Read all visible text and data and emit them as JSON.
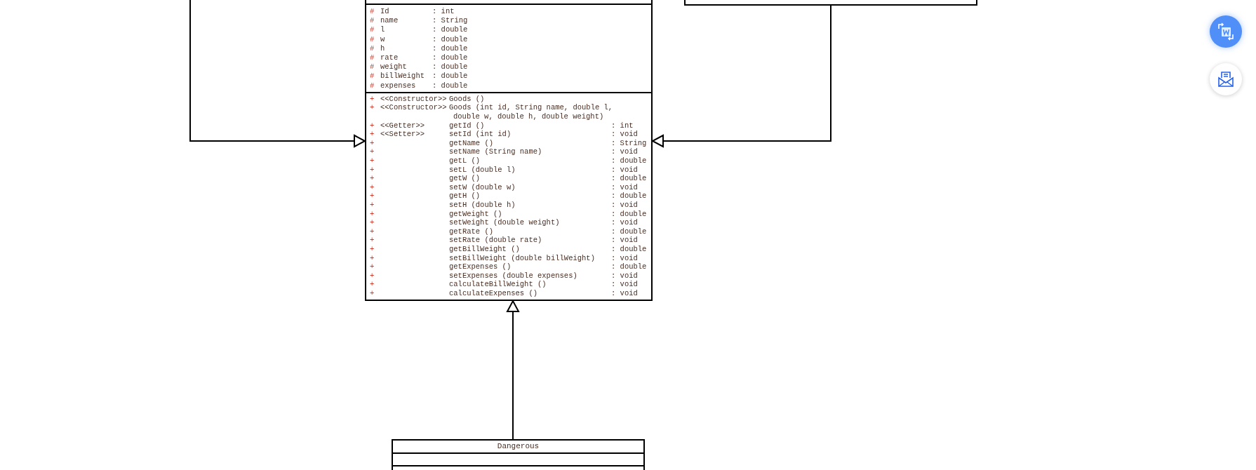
{
  "goods_class": {
    "attributes": [
      {
        "visibility": "#",
        "name": "Id",
        "type": ": int"
      },
      {
        "visibility": "#",
        "name": "name",
        "type": ": String"
      },
      {
        "visibility": "#",
        "name": "l",
        "type": ": double"
      },
      {
        "visibility": "#",
        "name": "w",
        "type": ": double"
      },
      {
        "visibility": "#",
        "name": "h",
        "type": ": double"
      },
      {
        "visibility": "#",
        "name": "rate",
        "type": ": double"
      },
      {
        "visibility": "#",
        "name": "weight",
        "type": ": double"
      },
      {
        "visibility": "#",
        "name": "billWeight",
        "type": ": double"
      },
      {
        "visibility": "#",
        "name": "expenses",
        "type": ": double"
      }
    ],
    "methods": [
      {
        "visibility": "+",
        "stereotype": "<<Constructor>>",
        "lines": [
          "Goods ()"
        ]
      },
      {
        "visibility": "+",
        "stereotype": "<<Constructor>>",
        "lines": [
          "Goods (int id, String name, double l,",
          "double w, double h, double weight)"
        ]
      },
      {
        "visibility": "+",
        "stereotype": "<<Getter>>",
        "lines": [
          "getId ()"
        ],
        "type": ": int"
      },
      {
        "visibility": "+",
        "stereotype": "<<Setter>>",
        "lines": [
          "setId (int id)"
        ],
        "type": ": void"
      },
      {
        "visibility": "+",
        "lines": [
          "getName ()"
        ],
        "type": ": String"
      },
      {
        "visibility": "+",
        "lines": [
          "setName (String name)"
        ],
        "type": ": void"
      },
      {
        "visibility": "+",
        "lines": [
          "getL ()"
        ],
        "type": ": double"
      },
      {
        "visibility": "+",
        "lines": [
          "setL (double l)"
        ],
        "type": ": void"
      },
      {
        "visibility": "+",
        "lines": [
          "getW ()"
        ],
        "type": ": double"
      },
      {
        "visibility": "+",
        "lines": [
          "setW (double w)"
        ],
        "type": ": void"
      },
      {
        "visibility": "+",
        "lines": [
          "getH ()"
        ],
        "type": ": double"
      },
      {
        "visibility": "+",
        "lines": [
          "setH (double h)"
        ],
        "type": ": void"
      },
      {
        "visibility": "+",
        "lines": [
          "getWeight ()"
        ],
        "type": ": double"
      },
      {
        "visibility": "+",
        "lines": [
          "setWeight (double weight)"
        ],
        "type": ": void"
      },
      {
        "visibility": "+",
        "lines": [
          "getRate ()"
        ],
        "type": ": double"
      },
      {
        "visibility": "+",
        "lines": [
          "setRate (double rate)"
        ],
        "type": ": void"
      },
      {
        "visibility": "+",
        "lines": [
          "getBillWeight ()"
        ],
        "type": ": double"
      },
      {
        "visibility": "+",
        "lines": [
          "setBillWeight (double billWeight)"
        ],
        "type": ": void"
      },
      {
        "visibility": "+",
        "lines": [
          "getExpenses ()"
        ],
        "type": ": double"
      },
      {
        "visibility": "+",
        "lines": [
          "setExpenses (double expenses)"
        ],
        "type": ": void"
      },
      {
        "visibility": "+",
        "lines": [
          "calculateBillWeight ()"
        ],
        "type": ": void"
      },
      {
        "visibility": "+",
        "lines": [
          "calculateExpenses ()"
        ],
        "type": ": void"
      }
    ]
  },
  "dangerous_class": {
    "name": "Dangerous"
  },
  "side_buttons": [
    {
      "kind": "translate"
    },
    {
      "kind": "mail"
    }
  ]
}
